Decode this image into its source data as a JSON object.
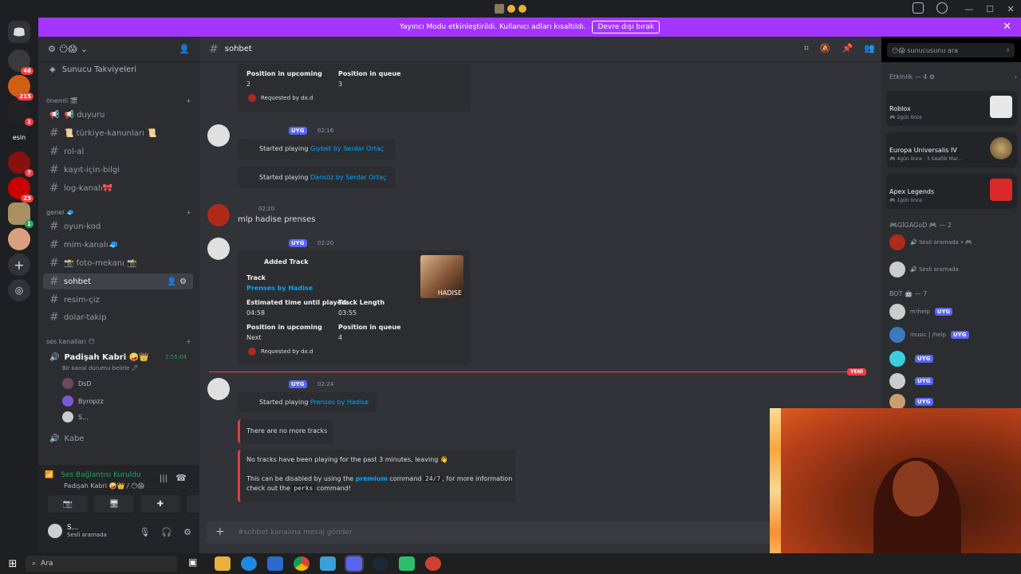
{
  "banner": {
    "text": "Yayıncı Modu etkinleştirildi. Kullanıcı adları kısaltıldı.",
    "button": "Devre dışı bırak"
  },
  "guilds": {
    "badges": [
      "46",
      "215",
      "1",
      "esin",
      "7",
      "23",
      "1"
    ],
    "esin_label": "esin"
  },
  "sidebar": {
    "server_icons": "😶😱",
    "boost": "Sunucu Takviyeleri",
    "cat1": "önemli 🎬",
    "cat2": "genel 🧢",
    "cat3": "ses kanalları 😶",
    "channels": [
      "📢 duyuru",
      "📜 türkiye-kanunları 📜",
      "rol-al",
      "kayıt-için-bilgi",
      "log-kanalı🎀",
      "oyun-kod",
      "mim-kanalı🧢",
      "📸 foto-mekanı 📸",
      "sohbet",
      "resim-çiz",
      "dolar-takip"
    ],
    "voice_channel": "Padişah Kabri 🤪👑",
    "voice_time": "2:55:04",
    "voice_status": "Bir kanal durumu belirle 🖊",
    "voice_users": [
      "DsD",
      "Byropzz",
      "S..."
    ],
    "kabe": "Kabe"
  },
  "voice_panel": {
    "status": "Ses Bağlantısı Kuruldu",
    "sub": "Padişah Kabri 🤪👑 / 😶😱"
  },
  "user": {
    "name": "S...",
    "status": "Sesli aramada"
  },
  "main": {
    "channel": "sohbet",
    "composer": "#sohbet kanalına mesaj gönder"
  },
  "search": {
    "placeholder": "😶😱 sunucusunu ara"
  },
  "messages": {
    "e1_pos_up": "Position in upcoming",
    "e1_pos_up_v": "2",
    "e1_pos_q": "Position in queue",
    "e1_pos_q_v": "3",
    "e1_req": "Requested by dx.d",
    "m2_tag": "UYG",
    "m2_time": "02:16",
    "m2a_prefix": "Started playing",
    "m2a_link": "Gıybet by Serdar Ortaç",
    "m2b_prefix": "Started playing",
    "m2b_link": "Dansöz by Serdar Ortaç",
    "m3_time": "02:20",
    "m3_text": "mlp hadise prenses",
    "m4_tag": "UYG",
    "m4_time": "02:20",
    "e4_title": "Added Track",
    "e4_track": "Track",
    "e4_track_v": "Prenses by Hadise",
    "e4_est": "Estimated time until played",
    "e4_est_v": "04:58",
    "e4_len": "Track Length",
    "e4_len_v": "03:55",
    "e4_up": "Position in upcoming",
    "e4_up_v": "Next",
    "e4_q": "Position in queue",
    "e4_q_v": "4",
    "e4_req": "Requested by dx.d",
    "e4_img": "HADISE",
    "new_label": "YENİ",
    "m5_tag": "UYG",
    "m5_time": "02:24",
    "m5a_prefix": "Started playing",
    "m5a_link": "Prenses by Hadise",
    "m5b": "There are no more tracks",
    "m5c": "No tracks have been playing for the past 3 minutes, leaving 👋",
    "m5d_1": "This can be disabled by using the",
    "m5d_link": "premium",
    "m5d_2": "command",
    "m5d_code": "24/7",
    "m5d_3": ", for more information",
    "m5e_1": "check out the",
    "m5e_code": "perks",
    "m5e_2": "command!"
  },
  "members": {
    "activity_header": "Etkinlik — 4 ⚙",
    "acts": [
      {
        "name": "Roblox",
        "sub": "🎮 2gün önce"
      },
      {
        "name": "Europa Universalis IV",
        "sub": "🎮 4gün önce · 3 Saatlik Mar..."
      },
      {
        "name": "Apex Legends",
        "sub": "🎮 1gün önce"
      }
    ],
    "grp1": "🎮GİGAGoD 🎮 — 2",
    "m1_status": "🔊 Sesli aramada • 🎮",
    "m2_status": "🔊 Sesli aramada",
    "grp2": "BOT 🤖 — 7",
    "bots": [
      {
        "tag": "UYG",
        "sub": "m!help"
      },
      {
        "tag": "UYG",
        "sub": "music | /help"
      },
      {
        "tag": "UYG",
        "sub": ""
      },
      {
        "tag": "UYG",
        "sub": ""
      },
      {
        "tag": "UYG",
        "sub": ""
      }
    ]
  },
  "taskbar": {
    "search": "Ara"
  }
}
